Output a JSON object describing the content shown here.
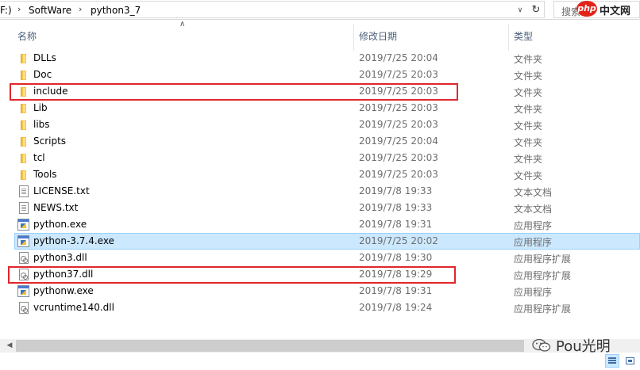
{
  "address": {
    "drive": "F:)",
    "segments": [
      "SoftWare",
      "python3_7"
    ],
    "search_placeholder": "搜索",
    "php_logo": "php",
    "php_site": "中文网"
  },
  "columns": {
    "name": "名称",
    "date": "修改日期",
    "type": "类型"
  },
  "files": [
    {
      "name": "DLLs",
      "date": "2019/7/25 20:04",
      "type": "文件夹",
      "icon": "folder"
    },
    {
      "name": "Doc",
      "date": "2019/7/25 20:03",
      "type": "文件夹",
      "icon": "folder"
    },
    {
      "name": "include",
      "date": "2019/7/25 20:03",
      "type": "文件夹",
      "icon": "folder"
    },
    {
      "name": "Lib",
      "date": "2019/7/25 20:03",
      "type": "文件夹",
      "icon": "folder"
    },
    {
      "name": "libs",
      "date": "2019/7/25 20:03",
      "type": "文件夹",
      "icon": "folder"
    },
    {
      "name": "Scripts",
      "date": "2019/7/25 20:04",
      "type": "文件夹",
      "icon": "folder"
    },
    {
      "name": "tcl",
      "date": "2019/7/25 20:03",
      "type": "文件夹",
      "icon": "folder"
    },
    {
      "name": "Tools",
      "date": "2019/7/25 20:03",
      "type": "文件夹",
      "icon": "folder"
    },
    {
      "name": "LICENSE.txt",
      "date": "2019/7/8 19:33",
      "type": "文本文档",
      "icon": "text-document"
    },
    {
      "name": "NEWS.txt",
      "date": "2019/7/8 19:33",
      "type": "文本文档",
      "icon": "text-document"
    },
    {
      "name": "python.exe",
      "date": "2019/7/8 19:31",
      "type": "应用程序",
      "icon": "python-exe"
    },
    {
      "name": "python-3.7.4.exe",
      "date": "2019/7/25 20:02",
      "type": "应用程序",
      "icon": "installer-exe"
    },
    {
      "name": "python3.dll",
      "date": "2019/7/8 19:30",
      "type": "应用程序扩展",
      "icon": "dll"
    },
    {
      "name": "python37.dll",
      "date": "2019/7/8 19:29",
      "type": "应用程序扩展",
      "icon": "dll"
    },
    {
      "name": "pythonw.exe",
      "date": "2019/7/8 19:31",
      "type": "应用程序",
      "icon": "python-exe"
    },
    {
      "name": "vcruntime140.dll",
      "date": "2019/7/8 19:24",
      "type": "应用程序扩展",
      "icon": "dll"
    }
  ],
  "selected_file": "python-3.7.4.exe",
  "highlighted_files": [
    "include",
    "python37.dll"
  ],
  "watermark": "Pou光明",
  "colors": {
    "selection_bg": "#cce8ff",
    "selection_border": "#99d1ff",
    "highlight_box": "#e0262d",
    "column_header_text": "#4c607a",
    "secondary_text": "#6d6d6d"
  }
}
